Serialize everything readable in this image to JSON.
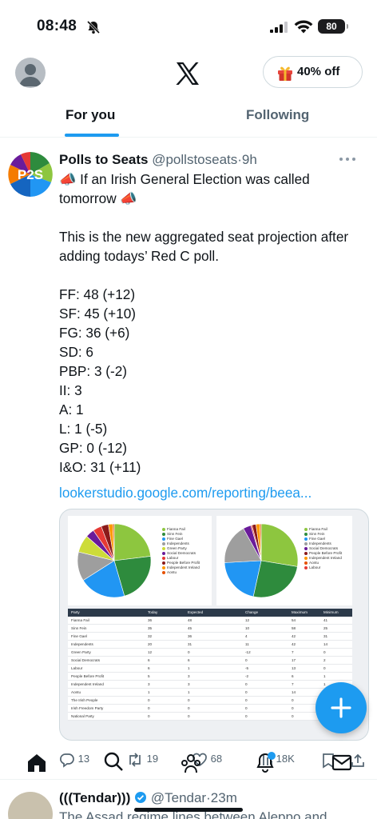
{
  "status": {
    "time": "08:48",
    "battery": "80"
  },
  "header": {
    "offer_label": "40% off"
  },
  "tabs": [
    {
      "label": "For you"
    },
    {
      "label": "Following"
    }
  ],
  "post": {
    "name": "Polls to Seats",
    "handle": "@pollstoseats",
    "time": "9h",
    "avatar_text": "P2S",
    "text": "📣 If an Irish General Election was called tomorrow 📣\n\nThis is the new aggregated seat projection after adding todays’ Red C poll.\n\nFF: 48 (+12)\nSF: 45 (+10)\nFG: 36 (+6)\nSD: 6\nPBP: 3 (-2)\nII: 3\nA: 1\nL: 1 (-5)\nGP: 0 (-12)\nI&O: 31 (+11)",
    "link": "lookerstudio.google.com/reporting/beea...",
    "card": {
      "legend_left": [
        "Fianna Fail",
        "Sinn Fein",
        "Fine Gael",
        "Independents",
        "Green Party",
        "Social Democrats",
        "Labour",
        "People Before Profit",
        "Independent Ireland",
        "Aontu"
      ],
      "legend_right": [
        "Fianna Fail",
        "Sinn Fein",
        "Fine Gael",
        "Independents",
        "Social Democrats",
        "People Before Profit",
        "Independent Ireland",
        "Aontu",
        "Labour"
      ],
      "columns": [
        "Party",
        "Today",
        "Expected",
        "Change",
        "Maximum",
        "Minimum"
      ],
      "rows": [
        [
          "Fianna Fail",
          "36",
          "48",
          "12",
          "54",
          "41"
        ],
        [
          "Sinn Fein",
          "35",
          "45",
          "10",
          "58",
          "25"
        ],
        [
          "Fine Gael",
          "32",
          "36",
          "4",
          "42",
          "31"
        ],
        [
          "Independents",
          "20",
          "31",
          "11",
          "42",
          "14"
        ],
        [
          "Green Party",
          "12",
          "0",
          "-12",
          "7",
          "0"
        ],
        [
          "Social Democrats",
          "6",
          "6",
          "0",
          "17",
          "2"
        ],
        [
          "Labour",
          "6",
          "1",
          "-5",
          "13",
          "0"
        ],
        [
          "People Before Profit",
          "5",
          "3",
          "-2",
          "6",
          "1"
        ],
        [
          "Independent Ireland",
          "3",
          "3",
          "0",
          "7",
          "1"
        ],
        [
          "Aontu",
          "1",
          "1",
          "0",
          "14",
          "0"
        ],
        [
          "The Irish People",
          "0",
          "0",
          "0",
          "0",
          "0"
        ],
        [
          "Irish Freedom Party",
          "0",
          "0",
          "0",
          "0",
          "0"
        ],
        [
          "National Party",
          "0",
          "0",
          "0",
          "0",
          "0"
        ]
      ],
      "colors": {
        "fianna_fail": "#8dc63f",
        "sinn_fein": "#2e8b3d",
        "fine_gael": "#2196f3",
        "independents": "#9e9e9e",
        "green_party": "#cddc39",
        "social_democrats": "#6a1b9a",
        "labour": "#e53935",
        "pbp": "#8b1a1a",
        "independent_ireland": "#ff9800",
        "aontu": "#e65100"
      }
    },
    "actions": {
      "replies": "13",
      "reposts": "19",
      "likes": "68",
      "views": "18K"
    }
  },
  "next_post": {
    "name": "(((Tendar)))",
    "handle": "@Tendar",
    "time": "23m",
    "text": "The Assad regime lines between Aleppo and"
  }
}
